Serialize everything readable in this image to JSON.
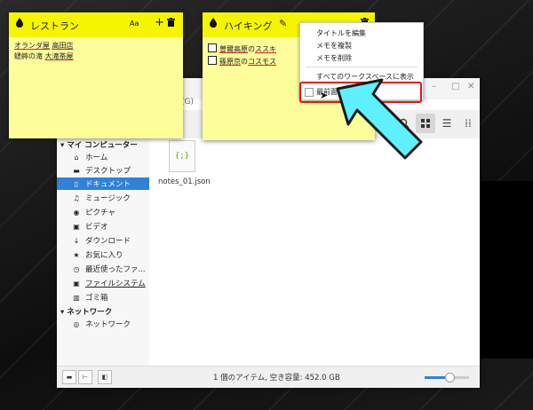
{
  "note1": {
    "title": "レストラン",
    "font_icon": "Aa",
    "add_icon": "+",
    "delete_icon": "trash-icon",
    "lines": [
      {
        "a": "オランダ屋",
        "b": "高田店"
      },
      {
        "a": "蟋蟀の滝",
        "b": "大滝茶屋"
      }
    ]
  },
  "note2": {
    "title": "ハイキング",
    "items": [
      {
        "a": "曽爾高原",
        "p": "の",
        "b": "ススキ"
      },
      {
        "a": "篠原京",
        "p": "の",
        "b": "コスモス"
      }
    ]
  },
  "context_menu": {
    "items": [
      "タイトルを編集",
      "メモを複製",
      "メモを削除",
      "すべてのワークスペースに表示",
      "最前面に固定"
    ]
  },
  "file_manager": {
    "menu_letter": "(G)",
    "path_label": "ド",
    "sidebar": {
      "heading_computer": "マイ コンピューター",
      "items": [
        {
          "label": "ホーム",
          "icon": "home-icon"
        },
        {
          "label": "デスクトップ",
          "icon": "desktop-icon"
        },
        {
          "label": "ドキュメント",
          "icon": "document-icon",
          "selected": true
        },
        {
          "label": "ミュージック",
          "icon": "music-icon"
        },
        {
          "label": "ピクチャ",
          "icon": "camera-icon"
        },
        {
          "label": "ビデオ",
          "icon": "video-icon"
        },
        {
          "label": "ダウンロード",
          "icon": "download-icon"
        },
        {
          "label": "お気に入り",
          "icon": "star-icon"
        },
        {
          "label": "最近使ったファ...",
          "icon": "clock-icon"
        },
        {
          "label": "ファイルシステム",
          "icon": "drive-icon"
        },
        {
          "label": "ゴミ箱",
          "icon": "trash-icon"
        }
      ],
      "heading_network": "ネットワーク",
      "network_items": [
        {
          "label": "ネットワーク",
          "icon": "network-icon"
        }
      ]
    },
    "file": {
      "icon_text": "{;}",
      "name": "notes_01.json"
    },
    "status": "1 個のアイテム, 空き容量: 452.0 GB",
    "zoom_fraction": 0.55
  },
  "colors": {
    "note_header": "#f5f500",
    "note_body": "#fdfd9a",
    "selection": "#2f82d6",
    "highlight": "#e11111",
    "arrow": "#5ff0ff"
  }
}
